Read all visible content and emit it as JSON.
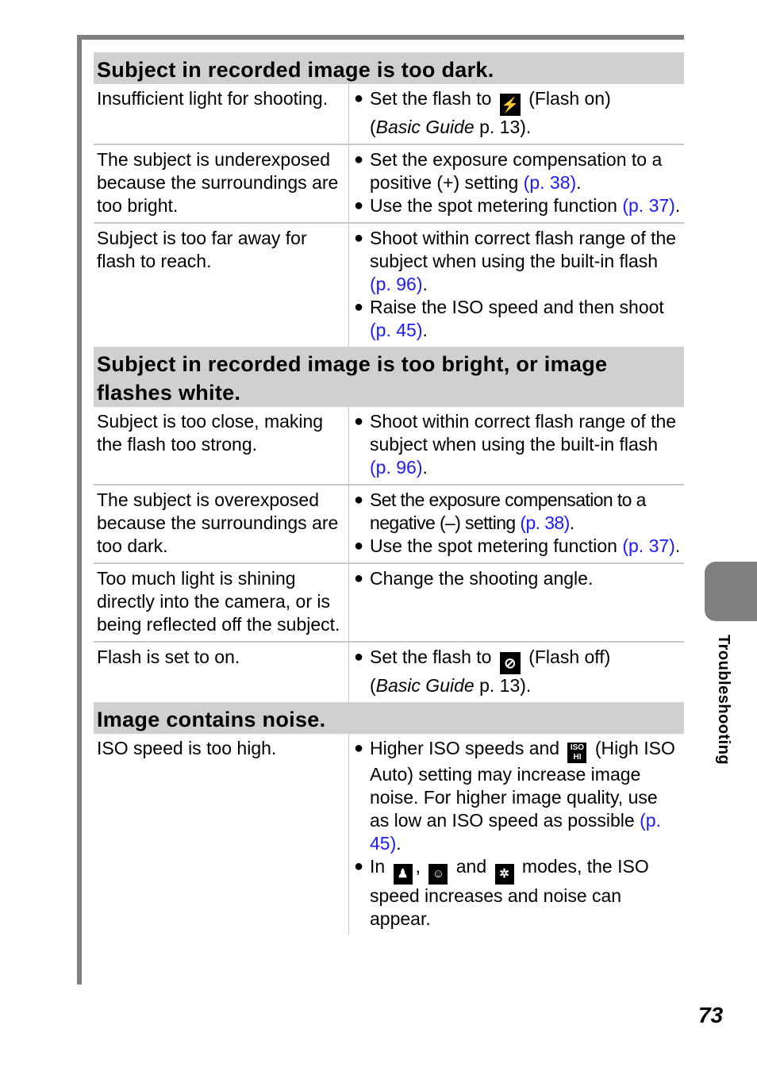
{
  "sections": [
    {
      "title": "Subject in recorded image is too dark.",
      "rows": [
        {
          "cause": "Insufficient light for shooting.",
          "bullets": [
            {
              "pre": "Set the flash to",
              "icon": "flash-on-icon",
              "icon_glyph": "⚡",
              "post": "(Flash on)",
              "post2_pre": "(",
              "italic": "Basic Guide",
              "post2": " p. 13)."
            }
          ]
        },
        {
          "cause": "The subject is underexposed because the surroundings are too bright.",
          "bullets": [
            {
              "text": "Set the exposure compensation to a positive (+) setting ",
              "link": "(p. 38)",
              "end": "."
            },
            {
              "text": "Use the spot metering function ",
              "link": "(p. 37)",
              "end": "."
            }
          ]
        },
        {
          "cause": "Subject is too far away for flash to reach.",
          "bullets": [
            {
              "text": "Shoot within correct flash range of the subject when using the built-in flash ",
              "link": "(p. 96)",
              "end": "."
            },
            {
              "text": "Raise the ISO speed and then shoot ",
              "link": "(p. 45)",
              "end": "."
            }
          ]
        }
      ]
    },
    {
      "title": "Subject in recorded image is too bright, or image flashes white.",
      "rows": [
        {
          "cause": "Subject is too close, making the flash too strong.",
          "bullets": [
            {
              "text": "Shoot within correct flash range of the subject when using the built-in flash ",
              "link": "(p. 96)",
              "end": "."
            }
          ]
        },
        {
          "cause": "The subject is overexposed because the surroundings are too dark.",
          "bullets": [
            {
              "text": "Set the exposure compensation to a negative (–) setting ",
              "link": "(p. 38)",
              "end": "."
            },
            {
              "text": "Use the spot metering function ",
              "link": "(p. 37)",
              "end": "."
            }
          ]
        },
        {
          "cause": "Too much light is shining directly into the camera, or is being reflected off the subject.",
          "bullets": [
            {
              "text": "Change the shooting angle."
            }
          ]
        },
        {
          "cause": "Flash is set to on.",
          "bullets": [
            {
              "pre": "Set the flash to",
              "icon": "flash-off-icon",
              "icon_glyph": "⊘",
              "post": "(Flash off)",
              "post2_pre": "(",
              "italic": "Basic Guide",
              "post2": " p. 13)."
            }
          ]
        }
      ]
    },
    {
      "title": "Image contains noise.",
      "rows": [
        {
          "cause": "ISO speed is too high.",
          "bullets": [
            {
              "pre": "Higher ISO speeds and",
              "icon": "high-iso-auto-icon",
              "icon_glyph": "ISO HI",
              "post": "(High ISO Auto) setting may increase image noise. For higher image quality, use as low an ISO speed as possible ",
              "link": "(p. 45)",
              "end": "."
            },
            {
              "in": "In",
              "icons": [
                "indoor-mode-icon",
                "kids-pets-mode-icon",
                "party-mode-icon"
              ],
              "and": "and",
              "tail": "modes, the ISO speed increases and noise can appear."
            }
          ]
        }
      ]
    }
  ],
  "side_tab": {
    "label": "Troubleshooting"
  },
  "page_number": "73"
}
